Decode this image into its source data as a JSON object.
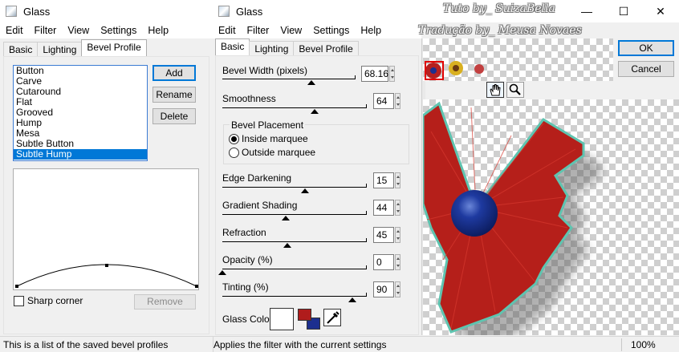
{
  "left_window": {
    "title": "Glass",
    "menu": [
      "Edit",
      "Filter",
      "View",
      "Settings",
      "Help"
    ],
    "tabs": [
      "Basic",
      "Lighting",
      "Bevel Profile"
    ],
    "profiles": [
      "Button",
      "Carve",
      "Cutaround",
      "Flat",
      "Grooved",
      "Hump",
      "Mesa",
      "Subtle Button",
      "Subtle Hump"
    ],
    "selected_profile": "Subtle Hump",
    "buttons": {
      "add": "Add",
      "rename": "Rename",
      "delete": "Delete",
      "remove": "Remove"
    },
    "sharp_corner_label": "Sharp corner",
    "sharp_corner_checked": false,
    "status": "This is a list of the saved bevel profiles"
  },
  "right_window": {
    "title": "Glass",
    "menu": [
      "Edit",
      "Filter",
      "View",
      "Settings",
      "Help"
    ],
    "tabs": [
      "Basic",
      "Lighting",
      "Bevel Profile"
    ],
    "active_tab": "Basic",
    "bevel_width": {
      "label": "Bevel Width (pixels)",
      "value": "68.16",
      "fraction": 0.67
    },
    "smoothness": {
      "label": "Smoothness",
      "value": "64",
      "fraction": 0.64
    },
    "bevel_placement": {
      "label": "Bevel Placement",
      "inside": "Inside marquee",
      "outside": "Outside marquee",
      "selected": "inside"
    },
    "edge_darkening": {
      "label": "Edge Darkening",
      "value": "15",
      "fraction": 0.57
    },
    "gradient_shading": {
      "label": "Gradient Shading",
      "value": "44",
      "fraction": 0.44
    },
    "refraction": {
      "label": "Refraction",
      "value": "45",
      "fraction": 0.45
    },
    "opacity": {
      "label": "Opacity (%)",
      "value": "0",
      "fraction": 0.0
    },
    "tinting": {
      "label": "Tinting (%)",
      "value": "90",
      "fraction": 0.9
    },
    "glass_color_label": "Glass Color",
    "glass_color": "#ffffff",
    "swatch_fore": "#b01c1c",
    "swatch_back": "#1c2f8f",
    "ok": "OK",
    "cancel": "Cancel",
    "status": "Applies the filter with the current settings",
    "zoom": "100%"
  },
  "watermark": {
    "line1": "Tuto by_ SuizaBella",
    "line2": "Tradução by_ Meusa Novaes"
  }
}
